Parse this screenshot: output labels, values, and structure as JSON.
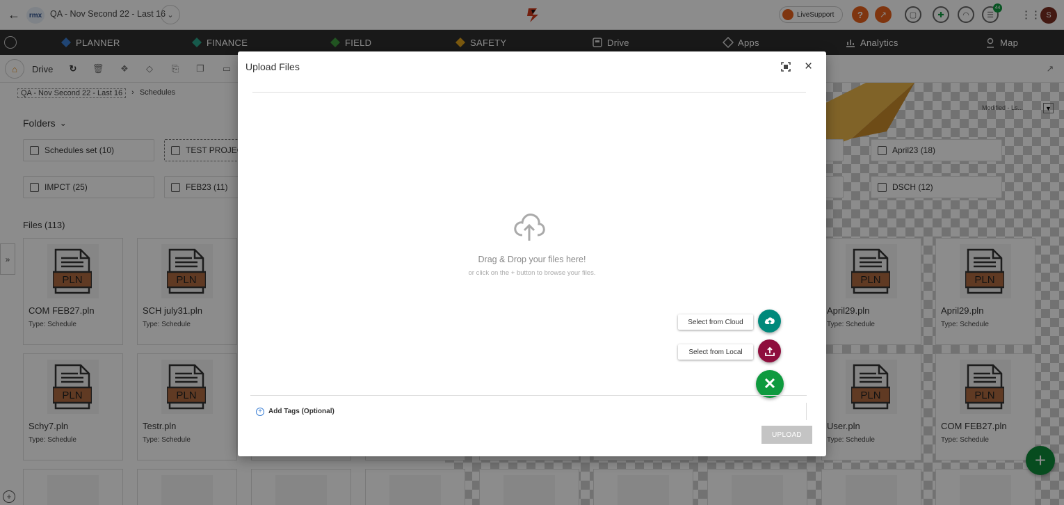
{
  "topbar": {
    "breadcrumb_project": "QA - Nov Second 22 - Last 16",
    "logo_text": "rmx",
    "livesupport_label": "LiveSupport",
    "notification_count": "44",
    "avatar_initial": "S"
  },
  "nav": {
    "items": [
      {
        "label": "PLANNER"
      },
      {
        "label": "FINANCE"
      },
      {
        "label": "FIELD"
      },
      {
        "label": "SAFETY"
      },
      {
        "label": "Drive"
      },
      {
        "label": "Apps"
      },
      {
        "label": "Analytics"
      },
      {
        "label": "Map"
      }
    ]
  },
  "toolbar": {
    "title": "Drive"
  },
  "breadcrumb": {
    "project": "QA - Nov Second 22 - Last 16",
    "separator": "›",
    "current": "Schedules"
  },
  "sort": {
    "label": "Modified - Ls..."
  },
  "folders": {
    "heading": "Folders",
    "items": [
      {
        "label": "Schedules set (10)"
      },
      {
        "label": "TEST PROJECT"
      },
      {
        "label": "April23 (18)"
      },
      {
        "label": "IMPCT (25)"
      },
      {
        "label": "FEB23 (11)"
      },
      {
        "label": "DSCH (12)"
      }
    ]
  },
  "files": {
    "heading": "Files (113)",
    "badge": "PLN",
    "items": [
      {
        "name": "COM FEB27.pln",
        "type": "Type: Schedule"
      },
      {
        "name": "SCH july31.pln",
        "type": "Type: Schedule"
      },
      {
        "name": "April29.pln",
        "type": "Type: Schedule"
      },
      {
        "name": "April29.pln",
        "type": "Type: Schedule"
      },
      {
        "name": "Schy7.pln",
        "type": "Type: Schedule"
      },
      {
        "name": "Testr.pln",
        "type": "Type: Schedule"
      },
      {
        "name": "User.pln",
        "type": "Type: Schedule"
      },
      {
        "name": "COM FEB27.pln",
        "type": "Type: Schedule"
      }
    ]
  },
  "modal": {
    "title": "Upload Files",
    "drop_title": "Drag & Drop your files here!",
    "drop_subtitle": "or click on the + button to browse your files.",
    "select_cloud": "Select from Cloud",
    "select_local": "Select from Local",
    "add_tags": "Add Tags (Optional)",
    "upload": "UPLOAD"
  },
  "colors": {
    "navbar": "#2f2f2f",
    "cloud_fab": "#00897b",
    "local_fab": "#8e0e3d",
    "close_fab": "#0e9a3e",
    "add_fab": "#0e8a3a",
    "pln_badge": "#b06a40"
  }
}
